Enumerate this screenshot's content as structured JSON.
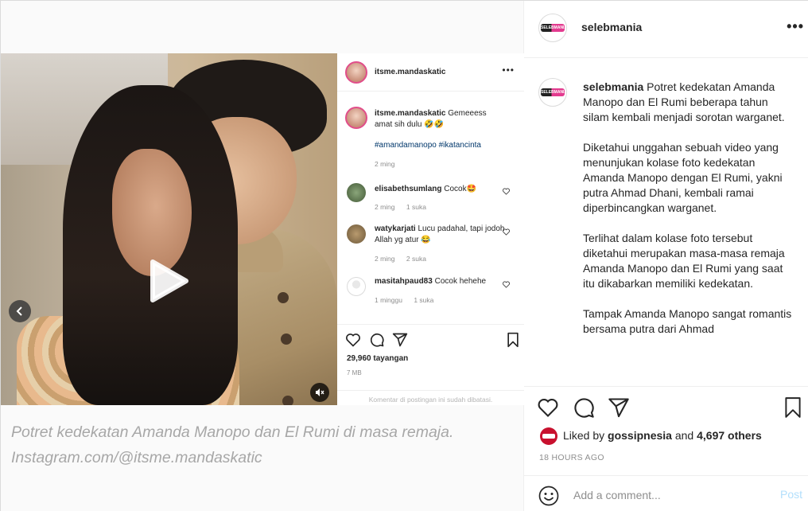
{
  "embed": {
    "username": "itsme.mandaskatic",
    "more_label": "•••",
    "comments": [
      {
        "user": "itsme.mandaskatic",
        "text": "Gemeeess amat sih dulu 🤣🤣",
        "hashtags": "#amandamanopo #ikatancinta",
        "time": "2 ming",
        "likes": ""
      },
      {
        "user": "elisabethsumlang",
        "text": "Cocok🤩",
        "time": "2 ming",
        "likes": "1 suka"
      },
      {
        "user": "watykarjati",
        "text": "Lucu padahal, tapi jodoh Allah yg atur 😂",
        "time": "2 ming",
        "likes": "2 suka"
      },
      {
        "user": "masitahpaud83",
        "text": "Cocok hehehe",
        "time": "1 minggu",
        "likes": "1 suka"
      }
    ],
    "views": "29,960 tayangan",
    "age": "7 MB",
    "comments_disabled": "Komentar di postingan ini sudah dibatasi."
  },
  "media_caption": {
    "line1": "Potret kedekatan Amanda Manopo dan El Rumi di masa remaja.",
    "line2": "Instagram.com/@itsme.mandaskatic"
  },
  "post": {
    "username": "selebmania",
    "avatar_text": "SELEBMANIA",
    "more_label": "•••",
    "caption_user": "selebmania",
    "caption_paragraphs": [
      " Potret kedekatan Amanda Manopo dan El Rumi beberapa tahun silam kembali menjadi sorotan warganet.",
      "Diketahui unggahan sebuah video yang menunjukan kolase foto kedekatan Amanda Manopo dengan El Rumi, yakni putra Ahmad Dhani, kembali ramai diperbincangkan warganet.",
      "Terlihat dalam kolase foto tersebut diketahui merupakan masa-masa remaja Amanda Manopo dan El Rumi yang saat itu dikabarkan memiliki kedekatan.",
      "Tampak Amanda Manopo sangat romantis bersama putra dari Ahmad"
    ],
    "liked_prefix": "Liked by ",
    "liked_user": "gossipnesia",
    "liked_mid": " and ",
    "liked_count": "4,697 others",
    "timestamp": "18 HOURS AGO",
    "comment_placeholder": "Add a comment...",
    "post_label": "Post"
  }
}
